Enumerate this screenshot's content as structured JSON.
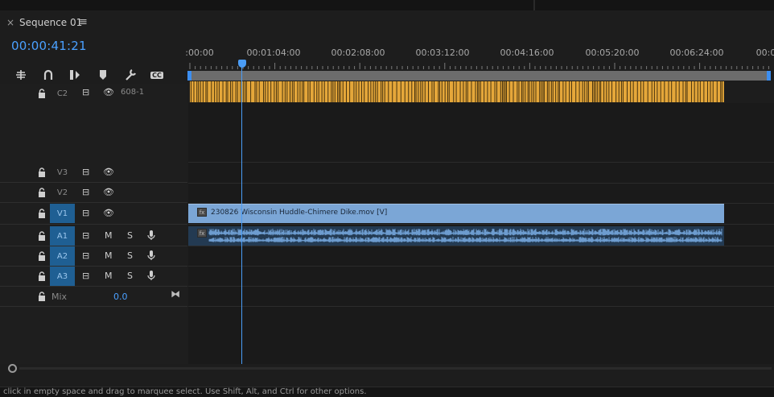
{
  "panel": {
    "close_glyph": "×",
    "tab_title": "Sequence 01",
    "menu_glyph": "≡",
    "timecode": "00:00:41:21"
  },
  "toolbar": {
    "icons": [
      "snap-icon",
      "linked-selection-icon",
      "insert-mark-icon",
      "add-marker-icon",
      "settings-wrench-icon",
      "captions-icon"
    ],
    "captions_label": "CC"
  },
  "ruler": {
    "labels": [
      ":00:00",
      "00:01:04:00",
      "00:02:08:00",
      "00:03:12:00",
      "00:04:16:00",
      "00:05:20:00",
      "00:06:24:00",
      "00:0"
    ]
  },
  "tracks": {
    "caption": {
      "name": "C2",
      "clip_label": "608-1"
    },
    "video": [
      {
        "name": "V3",
        "active": false
      },
      {
        "name": "V2",
        "active": false
      },
      {
        "name": "V1",
        "active": true
      }
    ],
    "audio": [
      {
        "name": "A1",
        "active": true,
        "mute": "M",
        "solo": "S"
      },
      {
        "name": "A2",
        "active": true,
        "mute": "M",
        "solo": "S"
      },
      {
        "name": "A3",
        "active": true,
        "mute": "M",
        "solo": "S"
      }
    ],
    "mix": {
      "label": "Mix",
      "value": "0.0"
    }
  },
  "clips": {
    "video_clip_label": "230826 Wisconsin Huddle-Chimere Dike.mov [V]",
    "fx_badge": "fx"
  },
  "status": {
    "text": "click in empty space and drag to marquee select. Use Shift, Alt, and Ctrl for other options."
  },
  "colors": {
    "accent": "#4aa0ff",
    "caption_clip": "#e5a73a",
    "video_clip": "#7ba6d6",
    "audio_clip": "#233a52",
    "active_track": "#1f5f93"
  }
}
